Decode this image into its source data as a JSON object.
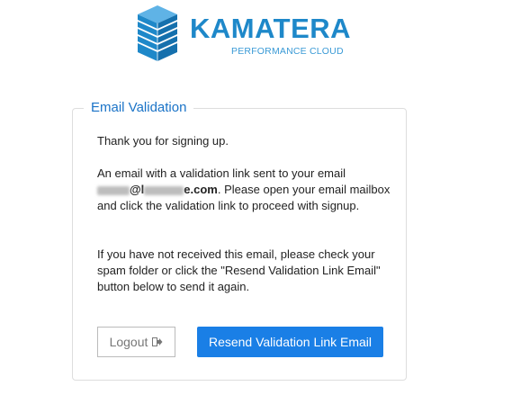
{
  "brand": {
    "name": "KAMATERA",
    "tagline": "PERFORMANCE CLOUD",
    "primary_color": "#1e88c9",
    "accent_color": "#1a7fe6"
  },
  "card": {
    "title": "Email Validation",
    "paragraph1": "Thank you for signing up.",
    "paragraph2_intro": "An email with a validation link sent to your email",
    "email_visible_at": "@l",
    "email_visible_domain": "e.com",
    "paragraph2_rest": ". Please open your email mailbox and click the validation link to proceed with signup.",
    "paragraph3": "If you have not received this email, please check your spam folder or click the \"Resend Validation Link Email\" button below to send it again."
  },
  "buttons": {
    "logout_label": "Logout",
    "logout_icon": "sign-out-icon",
    "resend_label": "Resend Validation Link Email"
  }
}
